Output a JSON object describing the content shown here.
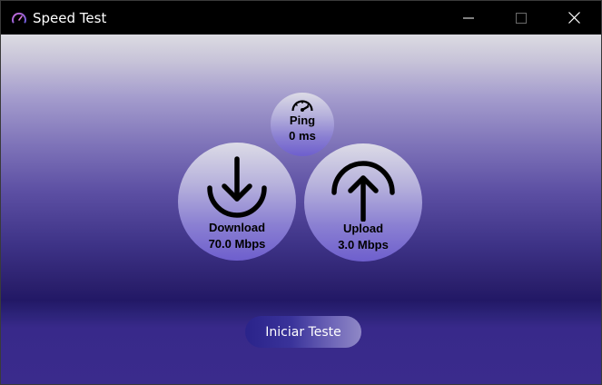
{
  "window": {
    "title": "Speed Test",
    "icon": "speedometer-icon"
  },
  "controls": {
    "minimize_icon": "minimize-icon",
    "maximize_icon": "maximize-icon",
    "close_icon": "close-icon"
  },
  "ping": {
    "label": "Ping",
    "value": "0 ms",
    "icon": "gauge-icon"
  },
  "download": {
    "label": "Download",
    "value": "70.0 Mbps",
    "icon": "download-arrow-icon"
  },
  "upload": {
    "label": "Upload",
    "value": "3.0 Mbps",
    "icon": "upload-arrow-icon"
  },
  "start_button": {
    "label": "Iniciar Teste"
  },
  "colors": {
    "accent": "#3a339a",
    "circle_bottom": "#6e5fcd",
    "background_dark": "#221866"
  }
}
